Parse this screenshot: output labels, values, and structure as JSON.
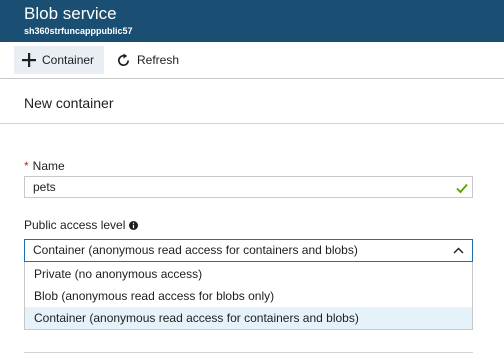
{
  "header": {
    "title": "Blob service",
    "subtitle": "sh360strfuncapppublic57"
  },
  "toolbar": {
    "container_label": "Container",
    "refresh_label": "Refresh"
  },
  "blade": {
    "title": "New container"
  },
  "form": {
    "required_marker": "*",
    "name_label": "Name",
    "name_value": "pets",
    "access_label": "Public access level",
    "access_selected": "Container (anonymous read access for containers and blobs)",
    "access_options": [
      "Private (no anonymous access)",
      "Blob (anonymous read access for blobs only)",
      "Container (anonymous read access for containers and blobs)"
    ]
  },
  "colors": {
    "header_bg": "#1b4e73",
    "accent": "#1b6fb5",
    "valid": "#57a300",
    "required": "#c42b1c",
    "selected_option_bg": "#e6f2fa"
  }
}
